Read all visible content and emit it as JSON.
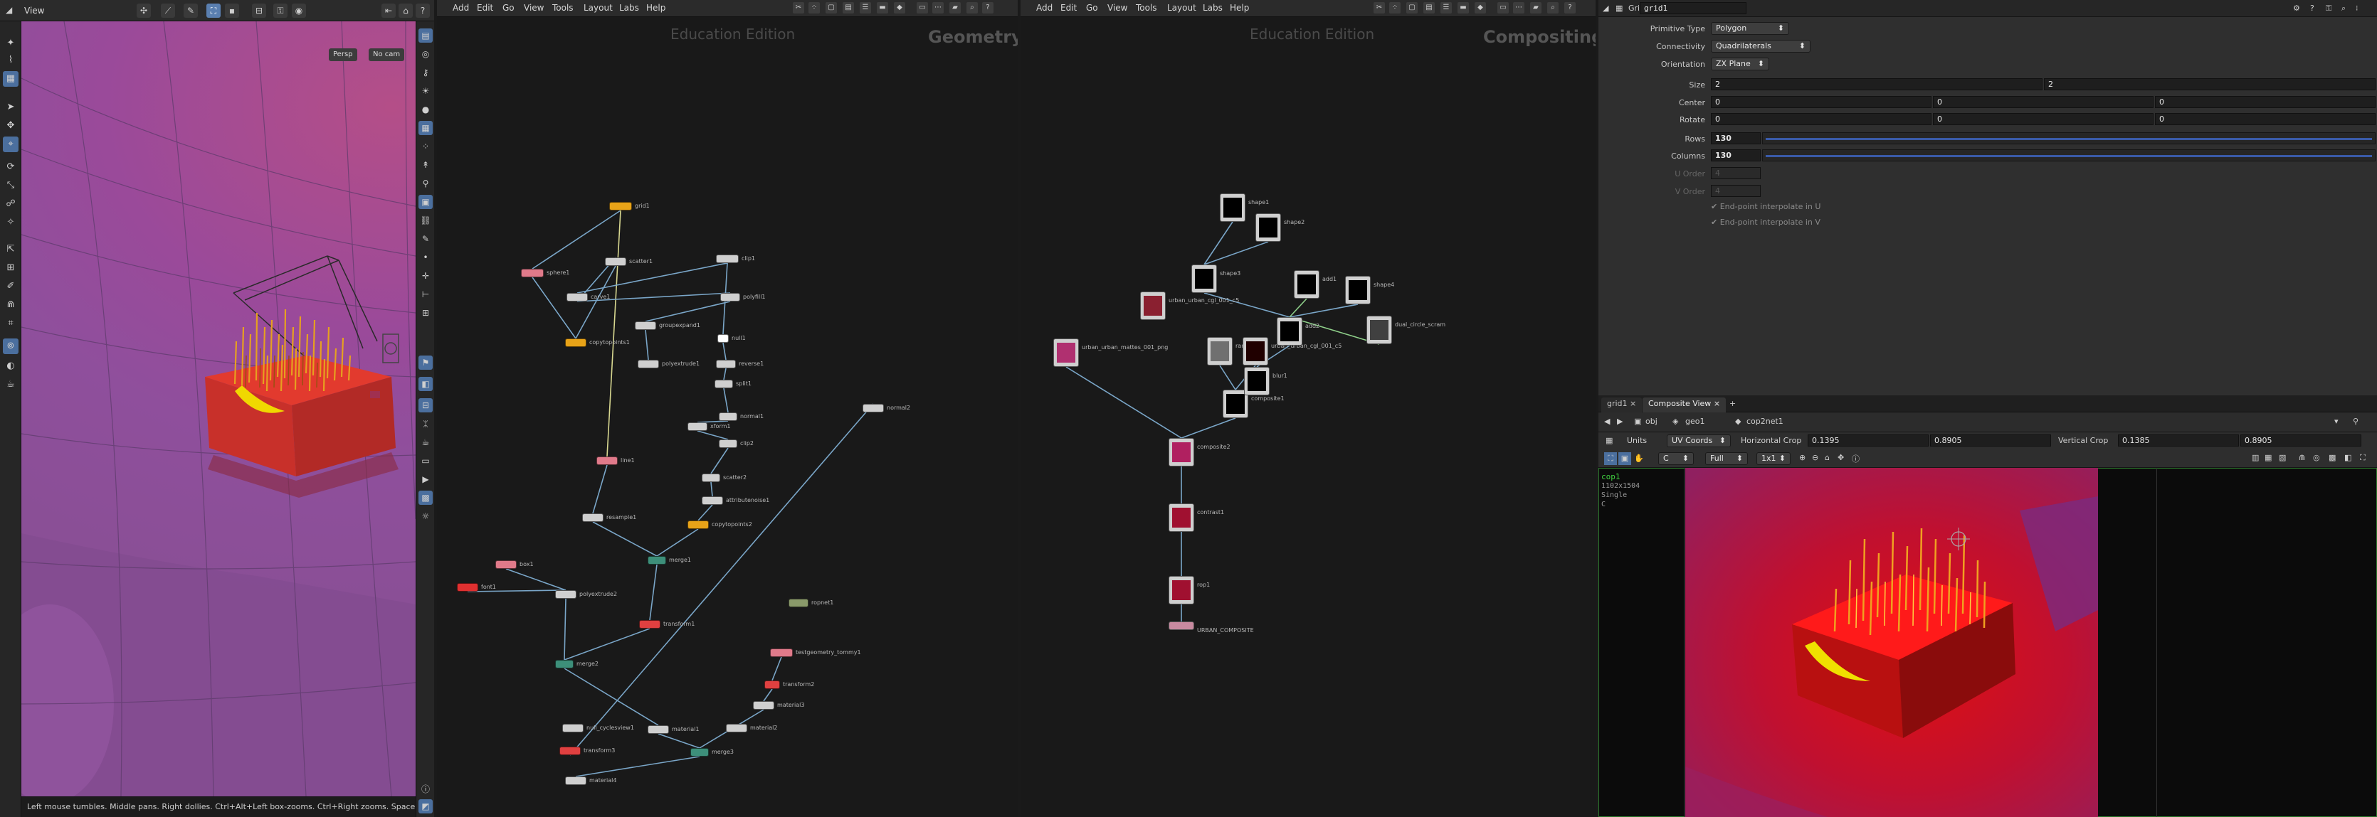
{
  "viewport": {
    "title": "View",
    "persp_label": "Persp",
    "cam_label": "No cam",
    "status_text": "Left mouse tumbles. Middle pans. Right dollies. Ctrl+Alt+Left box-zooms. Ctrl+Right zooms. Spacebar-Ctrl-"
  },
  "geometry_network": {
    "menu": [
      "Add",
      "Edit",
      "Go",
      "View",
      "Tools",
      "Layout",
      "Labs",
      "Help"
    ],
    "edition_label": "Education Edition",
    "context_label": "Geometry",
    "nodes": [
      {
        "label": "grid1",
        "color": "#e8a318"
      },
      {
        "label": "clip1",
        "color": "#cfcfcf"
      },
      {
        "label": "sphere1",
        "color": "#e07a8a"
      },
      {
        "label": "carve1",
        "color": "#cfcfcf"
      },
      {
        "label": "scatter1",
        "color": "#cfcfcf"
      },
      {
        "label": "polyfill1",
        "color": "#cfcfcf"
      },
      {
        "label": "copytopoints1",
        "color": "#e8a318"
      },
      {
        "label": "groupexpand1",
        "color": "#cfcfcf"
      },
      {
        "label": "polyextrude1",
        "color": "#cfcfcf"
      },
      {
        "label": "null1",
        "color": "#ffffff"
      },
      {
        "label": "reverse1",
        "color": "#cfcfcf"
      },
      {
        "label": "split1",
        "color": "#cfcfcf"
      },
      {
        "label": "normal1",
        "color": "#cfcfcf"
      },
      {
        "label": "xform1",
        "color": "#cfcfcf"
      },
      {
        "label": "clip2",
        "color": "#cfcfcf"
      },
      {
        "label": "line1",
        "color": "#e07a8a"
      },
      {
        "label": "scatter2",
        "color": "#cfcfcf"
      },
      {
        "label": "attributenoise1",
        "color": "#cfcfcf"
      },
      {
        "label": "resample1",
        "color": "#cfcfcf"
      },
      {
        "label": "copytopoints2",
        "color": "#e8a318"
      },
      {
        "label": "merge1",
        "color": "#3d8f7a"
      },
      {
        "label": "box1",
        "color": "#e07a8a"
      },
      {
        "label": "font1",
        "color": "#e03030"
      },
      {
        "label": "polyextrude2",
        "color": "#cfcfcf"
      },
      {
        "label": "transform1",
        "color": "#e04040"
      },
      {
        "label": "merge2",
        "color": "#3d8f7a"
      },
      {
        "label": "material1",
        "color": "#cfcfcf"
      },
      {
        "label": "material2",
        "color": "#cfcfcf"
      },
      {
        "label": "testgeometry_tommy1",
        "color": "#e07a8a"
      },
      {
        "label": "transform2",
        "color": "#e04040"
      },
      {
        "label": "material3",
        "color": "#cfcfcf"
      },
      {
        "label": "merge3",
        "color": "#3d8f7a"
      },
      {
        "label": "transform3",
        "color": "#e04040"
      },
      {
        "label": "material4",
        "color": "#cfcfcf"
      },
      {
        "label": "normal2",
        "color": "#cfcfcf"
      },
      {
        "label": "ropnet1",
        "color": "#8a9a6a"
      },
      {
        "label": "null_cyclesview1",
        "color": "#cfcfcf"
      }
    ]
  },
  "compositing_network": {
    "menu": [
      "Add",
      "Edit",
      "Go",
      "View",
      "Tools",
      "Layout",
      "Labs",
      "Help"
    ],
    "edition_label": "Education Edition",
    "context_label": "Compositing",
    "nodes": [
      {
        "label": "urban_urban_cgl_001_c5",
        "thumb": "#8a2030"
      },
      {
        "label": "urban_urban_mattes_001_png",
        "thumb": "#b03070"
      },
      {
        "label": "ramp1",
        "thumb": "#707070"
      },
      {
        "label": "urban_urban_cgl_001_c5",
        "thumb": "#200000"
      },
      {
        "label": "composite1",
        "thumb": "#000000"
      },
      {
        "label": "shape1",
        "thumb": "#000000"
      },
      {
        "label": "shape2",
        "thumb": "#000000"
      },
      {
        "label": "shape3",
        "thumb": "#000000"
      },
      {
        "label": "add1",
        "thumb": "#000000"
      },
      {
        "label": "shape4",
        "thumb": "#000000"
      },
      {
        "label": "add2",
        "thumb": "#000000"
      },
      {
        "label": "blur1",
        "thumb": "#000000"
      },
      {
        "label": "dual_circle_scram",
        "thumb": "#404040"
      },
      {
        "label": "composite2",
        "thumb": "#b02060"
      },
      {
        "label": "contrast1",
        "thumb": "#a01030"
      },
      {
        "label": "rop1",
        "thumb": "#a01030"
      },
      {
        "label": "URBAN_COMPOSITE",
        "thumb": ""
      }
    ]
  },
  "parameters": {
    "node_type": "Grid",
    "node_name": "grid1",
    "primitive_type": {
      "label": "Primitive Type",
      "value": "Polygon"
    },
    "connectivity": {
      "label": "Connectivity",
      "value": "Quadrilaterals"
    },
    "orientation": {
      "label": "Orientation",
      "value": "ZX Plane"
    },
    "size": {
      "label": "Size",
      "x": "2",
      "y": "2"
    },
    "center": {
      "label": "Center",
      "x": "0",
      "y": "0",
      "z": "0"
    },
    "rotate": {
      "label": "Rotate",
      "x": "0",
      "y": "0",
      "z": "0"
    },
    "rows": {
      "label": "Rows",
      "value": "130"
    },
    "columns": {
      "label": "Columns",
      "value": "130"
    },
    "u_order": {
      "label": "U Order",
      "value": "4"
    },
    "v_order": {
      "label": "V Order",
      "value": "4"
    },
    "end_u": "End-point interpolate in U",
    "end_v": "End-point interpolate in V"
  },
  "composite_view": {
    "tabs": [
      "grid1",
      "Composite View"
    ],
    "path": [
      "obj",
      "geo1",
      "cop2net1"
    ],
    "units_label": "Units",
    "units_value": "UV Coords",
    "hcrop_label": "Horizontal Crop",
    "hcrop_min": "0.1395",
    "hcrop_max": "0.8905",
    "vcrop_label": "Vertical Crop",
    "vcrop_min": "0.1385",
    "vcrop_max": "0.8905",
    "channel": "C",
    "scale": "Full",
    "ratio": "1x1",
    "info_name": "cop1",
    "info_res": "1102x1504",
    "info_mode": "Single",
    "info_c": "C"
  },
  "colors": {
    "accent_blue": "#4b6f9e",
    "scene_purple": "#8f4f9c",
    "cop_red": "#c81818",
    "wire": "#7aa6c8"
  }
}
